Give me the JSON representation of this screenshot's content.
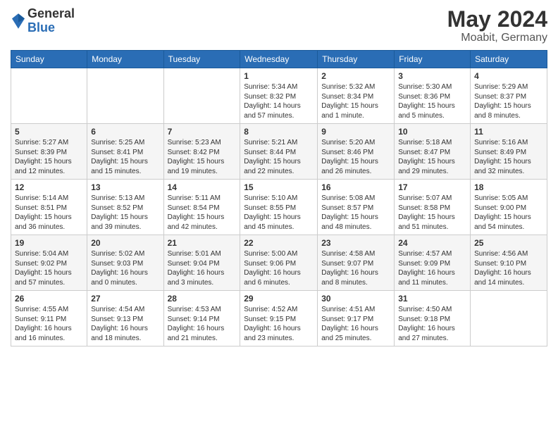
{
  "header": {
    "logo_general": "General",
    "logo_blue": "Blue",
    "title": "May 2024",
    "location": "Moabit, Germany"
  },
  "weekdays": [
    "Sunday",
    "Monday",
    "Tuesday",
    "Wednesday",
    "Thursday",
    "Friday",
    "Saturday"
  ],
  "weeks": [
    [
      {
        "day": "",
        "info": ""
      },
      {
        "day": "",
        "info": ""
      },
      {
        "day": "",
        "info": ""
      },
      {
        "day": "1",
        "info": "Sunrise: 5:34 AM\nSunset: 8:32 PM\nDaylight: 14 hours\nand 57 minutes."
      },
      {
        "day": "2",
        "info": "Sunrise: 5:32 AM\nSunset: 8:34 PM\nDaylight: 15 hours\nand 1 minute."
      },
      {
        "day": "3",
        "info": "Sunrise: 5:30 AM\nSunset: 8:36 PM\nDaylight: 15 hours\nand 5 minutes."
      },
      {
        "day": "4",
        "info": "Sunrise: 5:29 AM\nSunset: 8:37 PM\nDaylight: 15 hours\nand 8 minutes."
      }
    ],
    [
      {
        "day": "5",
        "info": "Sunrise: 5:27 AM\nSunset: 8:39 PM\nDaylight: 15 hours\nand 12 minutes."
      },
      {
        "day": "6",
        "info": "Sunrise: 5:25 AM\nSunset: 8:41 PM\nDaylight: 15 hours\nand 15 minutes."
      },
      {
        "day": "7",
        "info": "Sunrise: 5:23 AM\nSunset: 8:42 PM\nDaylight: 15 hours\nand 19 minutes."
      },
      {
        "day": "8",
        "info": "Sunrise: 5:21 AM\nSunset: 8:44 PM\nDaylight: 15 hours\nand 22 minutes."
      },
      {
        "day": "9",
        "info": "Sunrise: 5:20 AM\nSunset: 8:46 PM\nDaylight: 15 hours\nand 26 minutes."
      },
      {
        "day": "10",
        "info": "Sunrise: 5:18 AM\nSunset: 8:47 PM\nDaylight: 15 hours\nand 29 minutes."
      },
      {
        "day": "11",
        "info": "Sunrise: 5:16 AM\nSunset: 8:49 PM\nDaylight: 15 hours\nand 32 minutes."
      }
    ],
    [
      {
        "day": "12",
        "info": "Sunrise: 5:14 AM\nSunset: 8:51 PM\nDaylight: 15 hours\nand 36 minutes."
      },
      {
        "day": "13",
        "info": "Sunrise: 5:13 AM\nSunset: 8:52 PM\nDaylight: 15 hours\nand 39 minutes."
      },
      {
        "day": "14",
        "info": "Sunrise: 5:11 AM\nSunset: 8:54 PM\nDaylight: 15 hours\nand 42 minutes."
      },
      {
        "day": "15",
        "info": "Sunrise: 5:10 AM\nSunset: 8:55 PM\nDaylight: 15 hours\nand 45 minutes."
      },
      {
        "day": "16",
        "info": "Sunrise: 5:08 AM\nSunset: 8:57 PM\nDaylight: 15 hours\nand 48 minutes."
      },
      {
        "day": "17",
        "info": "Sunrise: 5:07 AM\nSunset: 8:58 PM\nDaylight: 15 hours\nand 51 minutes."
      },
      {
        "day": "18",
        "info": "Sunrise: 5:05 AM\nSunset: 9:00 PM\nDaylight: 15 hours\nand 54 minutes."
      }
    ],
    [
      {
        "day": "19",
        "info": "Sunrise: 5:04 AM\nSunset: 9:02 PM\nDaylight: 15 hours\nand 57 minutes."
      },
      {
        "day": "20",
        "info": "Sunrise: 5:02 AM\nSunset: 9:03 PM\nDaylight: 16 hours\nand 0 minutes."
      },
      {
        "day": "21",
        "info": "Sunrise: 5:01 AM\nSunset: 9:04 PM\nDaylight: 16 hours\nand 3 minutes."
      },
      {
        "day": "22",
        "info": "Sunrise: 5:00 AM\nSunset: 9:06 PM\nDaylight: 16 hours\nand 6 minutes."
      },
      {
        "day": "23",
        "info": "Sunrise: 4:58 AM\nSunset: 9:07 PM\nDaylight: 16 hours\nand 8 minutes."
      },
      {
        "day": "24",
        "info": "Sunrise: 4:57 AM\nSunset: 9:09 PM\nDaylight: 16 hours\nand 11 minutes."
      },
      {
        "day": "25",
        "info": "Sunrise: 4:56 AM\nSunset: 9:10 PM\nDaylight: 16 hours\nand 14 minutes."
      }
    ],
    [
      {
        "day": "26",
        "info": "Sunrise: 4:55 AM\nSunset: 9:11 PM\nDaylight: 16 hours\nand 16 minutes."
      },
      {
        "day": "27",
        "info": "Sunrise: 4:54 AM\nSunset: 9:13 PM\nDaylight: 16 hours\nand 18 minutes."
      },
      {
        "day": "28",
        "info": "Sunrise: 4:53 AM\nSunset: 9:14 PM\nDaylight: 16 hours\nand 21 minutes."
      },
      {
        "day": "29",
        "info": "Sunrise: 4:52 AM\nSunset: 9:15 PM\nDaylight: 16 hours\nand 23 minutes."
      },
      {
        "day": "30",
        "info": "Sunrise: 4:51 AM\nSunset: 9:17 PM\nDaylight: 16 hours\nand 25 minutes."
      },
      {
        "day": "31",
        "info": "Sunrise: 4:50 AM\nSunset: 9:18 PM\nDaylight: 16 hours\nand 27 minutes."
      },
      {
        "day": "",
        "info": ""
      }
    ]
  ]
}
